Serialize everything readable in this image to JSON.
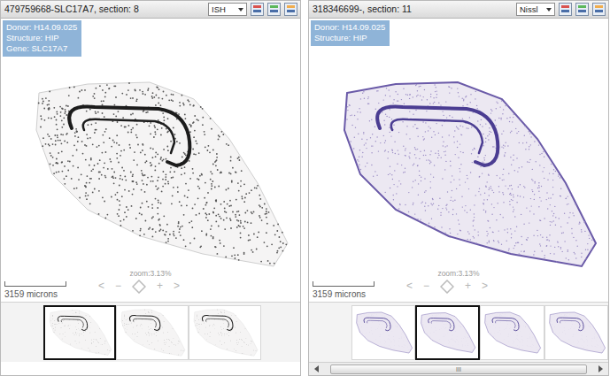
{
  "nav_controls": {
    "left": "<",
    "minus": "−",
    "plus": "+",
    "right": ">"
  },
  "panels": [
    {
      "title": "479759668-SLC17A7, section: 8",
      "mode": "ISH",
      "kind": "ish",
      "info": [
        "Donor: H14.09.025",
        "Structure: HIP",
        "Gene: SLC17A7"
      ],
      "zoom": "zoom:3.13%",
      "scale": "3159 microns",
      "thumbnails": [
        {
          "selected": true
        },
        {
          "selected": false
        },
        {
          "selected": false
        }
      ]
    },
    {
      "title": "318346699-, section: 11",
      "mode": "Nissl",
      "kind": "nissl",
      "info": [
        "Donor: H14.09.025",
        "Structure: HIP"
      ],
      "zoom": "zoom:3.13%",
      "scale": "3159 microns",
      "thumbnails": [
        {
          "selected": false
        },
        {
          "selected": true
        },
        {
          "selected": false
        },
        {
          "selected": false
        }
      ],
      "scrollbar_grip": "III"
    }
  ]
}
